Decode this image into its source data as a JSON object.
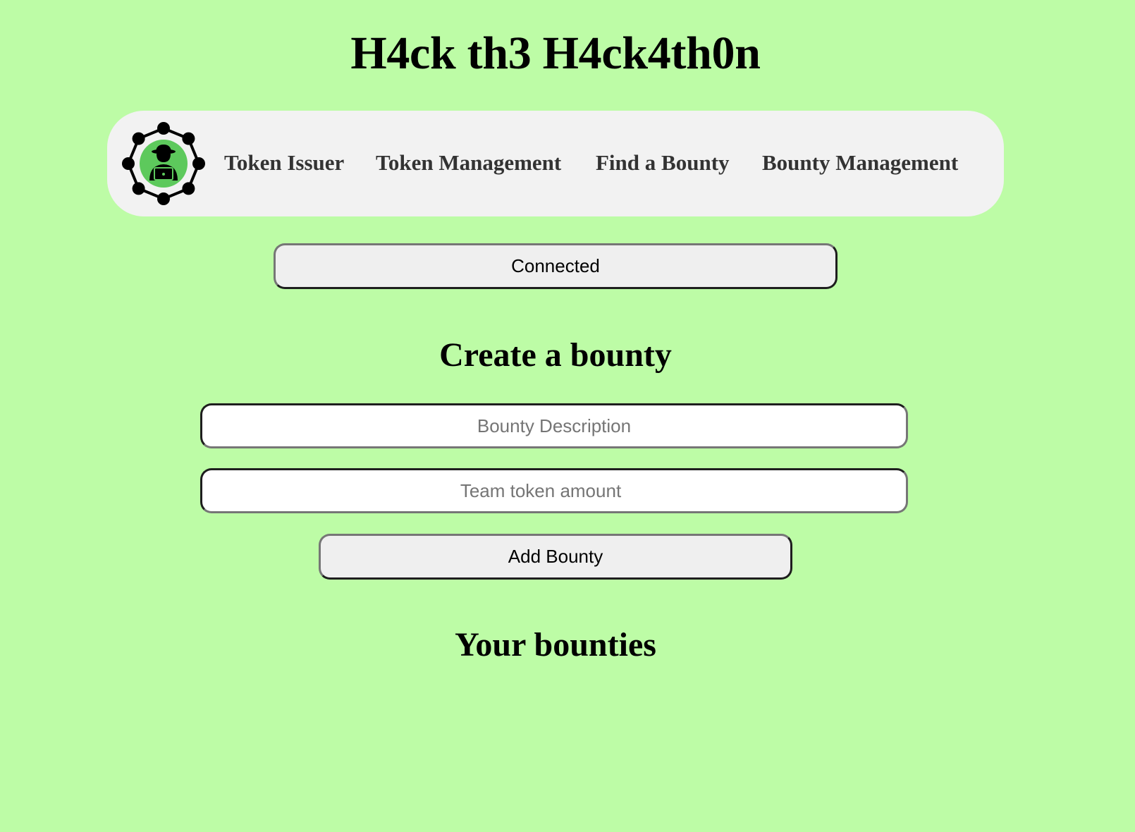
{
  "header": {
    "title": "H4ck th3 H4ck4th0n"
  },
  "nav": {
    "logo_icon": "hacker-network-logo-icon",
    "items": [
      {
        "label": "Token Issuer"
      },
      {
        "label": "Token Management"
      },
      {
        "label": "Find a Bounty"
      },
      {
        "label": "Bounty Management"
      }
    ]
  },
  "wallet": {
    "status_label": "Connected"
  },
  "create_bounty": {
    "heading": "Create a bounty",
    "description_field": {
      "value": "",
      "placeholder": "Bounty Description"
    },
    "amount_field": {
      "value": "",
      "placeholder": "Team token amount"
    },
    "submit_label": "Add Bounty"
  },
  "your_bounties": {
    "heading": "Your bounties",
    "items": []
  },
  "colors": {
    "background": "#bdfca6",
    "nav_background": "#f2f2f2",
    "logo_green": "#5dc95c",
    "nav_text": "#333333"
  }
}
